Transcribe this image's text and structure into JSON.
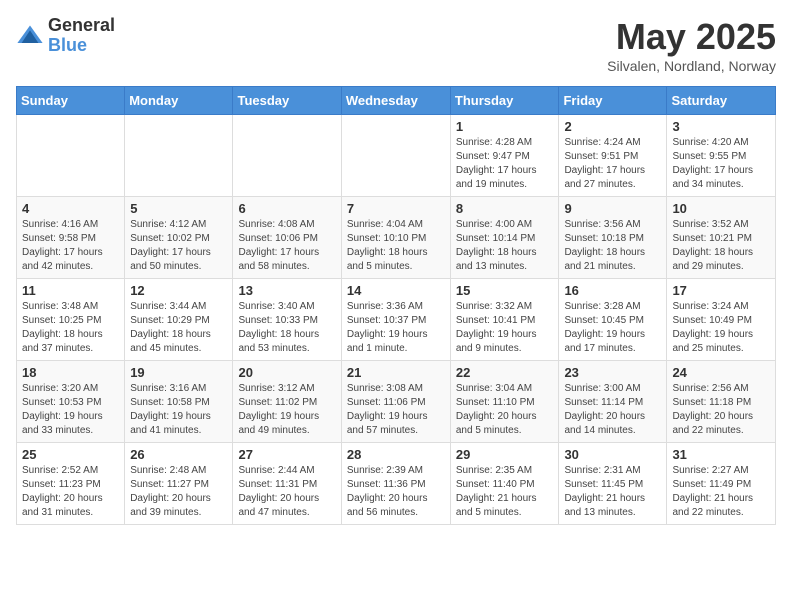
{
  "logo": {
    "general": "General",
    "blue": "Blue"
  },
  "title": {
    "month": "May 2025",
    "location": "Silvalen, Nordland, Norway"
  },
  "weekdays": [
    "Sunday",
    "Monday",
    "Tuesday",
    "Wednesday",
    "Thursday",
    "Friday",
    "Saturday"
  ],
  "weeks": [
    [
      {
        "day": "",
        "info": ""
      },
      {
        "day": "",
        "info": ""
      },
      {
        "day": "",
        "info": ""
      },
      {
        "day": "",
        "info": ""
      },
      {
        "day": "1",
        "info": "Sunrise: 4:28 AM\nSunset: 9:47 PM\nDaylight: 17 hours\nand 19 minutes."
      },
      {
        "day": "2",
        "info": "Sunrise: 4:24 AM\nSunset: 9:51 PM\nDaylight: 17 hours\nand 27 minutes."
      },
      {
        "day": "3",
        "info": "Sunrise: 4:20 AM\nSunset: 9:55 PM\nDaylight: 17 hours\nand 34 minutes."
      }
    ],
    [
      {
        "day": "4",
        "info": "Sunrise: 4:16 AM\nSunset: 9:58 PM\nDaylight: 17 hours\nand 42 minutes."
      },
      {
        "day": "5",
        "info": "Sunrise: 4:12 AM\nSunset: 10:02 PM\nDaylight: 17 hours\nand 50 minutes."
      },
      {
        "day": "6",
        "info": "Sunrise: 4:08 AM\nSunset: 10:06 PM\nDaylight: 17 hours\nand 58 minutes."
      },
      {
        "day": "7",
        "info": "Sunrise: 4:04 AM\nSunset: 10:10 PM\nDaylight: 18 hours\nand 5 minutes."
      },
      {
        "day": "8",
        "info": "Sunrise: 4:00 AM\nSunset: 10:14 PM\nDaylight: 18 hours\nand 13 minutes."
      },
      {
        "day": "9",
        "info": "Sunrise: 3:56 AM\nSunset: 10:18 PM\nDaylight: 18 hours\nand 21 minutes."
      },
      {
        "day": "10",
        "info": "Sunrise: 3:52 AM\nSunset: 10:21 PM\nDaylight: 18 hours\nand 29 minutes."
      }
    ],
    [
      {
        "day": "11",
        "info": "Sunrise: 3:48 AM\nSunset: 10:25 PM\nDaylight: 18 hours\nand 37 minutes."
      },
      {
        "day": "12",
        "info": "Sunrise: 3:44 AM\nSunset: 10:29 PM\nDaylight: 18 hours\nand 45 minutes."
      },
      {
        "day": "13",
        "info": "Sunrise: 3:40 AM\nSunset: 10:33 PM\nDaylight: 18 hours\nand 53 minutes."
      },
      {
        "day": "14",
        "info": "Sunrise: 3:36 AM\nSunset: 10:37 PM\nDaylight: 19 hours\nand 1 minute."
      },
      {
        "day": "15",
        "info": "Sunrise: 3:32 AM\nSunset: 10:41 PM\nDaylight: 19 hours\nand 9 minutes."
      },
      {
        "day": "16",
        "info": "Sunrise: 3:28 AM\nSunset: 10:45 PM\nDaylight: 19 hours\nand 17 minutes."
      },
      {
        "day": "17",
        "info": "Sunrise: 3:24 AM\nSunset: 10:49 PM\nDaylight: 19 hours\nand 25 minutes."
      }
    ],
    [
      {
        "day": "18",
        "info": "Sunrise: 3:20 AM\nSunset: 10:53 PM\nDaylight: 19 hours\nand 33 minutes."
      },
      {
        "day": "19",
        "info": "Sunrise: 3:16 AM\nSunset: 10:58 PM\nDaylight: 19 hours\nand 41 minutes."
      },
      {
        "day": "20",
        "info": "Sunrise: 3:12 AM\nSunset: 11:02 PM\nDaylight: 19 hours\nand 49 minutes."
      },
      {
        "day": "21",
        "info": "Sunrise: 3:08 AM\nSunset: 11:06 PM\nDaylight: 19 hours\nand 57 minutes."
      },
      {
        "day": "22",
        "info": "Sunrise: 3:04 AM\nSunset: 11:10 PM\nDaylight: 20 hours\nand 5 minutes."
      },
      {
        "day": "23",
        "info": "Sunrise: 3:00 AM\nSunset: 11:14 PM\nDaylight: 20 hours\nand 14 minutes."
      },
      {
        "day": "24",
        "info": "Sunrise: 2:56 AM\nSunset: 11:18 PM\nDaylight: 20 hours\nand 22 minutes."
      }
    ],
    [
      {
        "day": "25",
        "info": "Sunrise: 2:52 AM\nSunset: 11:23 PM\nDaylight: 20 hours\nand 31 minutes."
      },
      {
        "day": "26",
        "info": "Sunrise: 2:48 AM\nSunset: 11:27 PM\nDaylight: 20 hours\nand 39 minutes."
      },
      {
        "day": "27",
        "info": "Sunrise: 2:44 AM\nSunset: 11:31 PM\nDaylight: 20 hours\nand 47 minutes."
      },
      {
        "day": "28",
        "info": "Sunrise: 2:39 AM\nSunset: 11:36 PM\nDaylight: 20 hours\nand 56 minutes."
      },
      {
        "day": "29",
        "info": "Sunrise: 2:35 AM\nSunset: 11:40 PM\nDaylight: 21 hours\nand 5 minutes."
      },
      {
        "day": "30",
        "info": "Sunrise: 2:31 AM\nSunset: 11:45 PM\nDaylight: 21 hours\nand 13 minutes."
      },
      {
        "day": "31",
        "info": "Sunrise: 2:27 AM\nSunset: 11:49 PM\nDaylight: 21 hours\nand 22 minutes."
      }
    ]
  ]
}
